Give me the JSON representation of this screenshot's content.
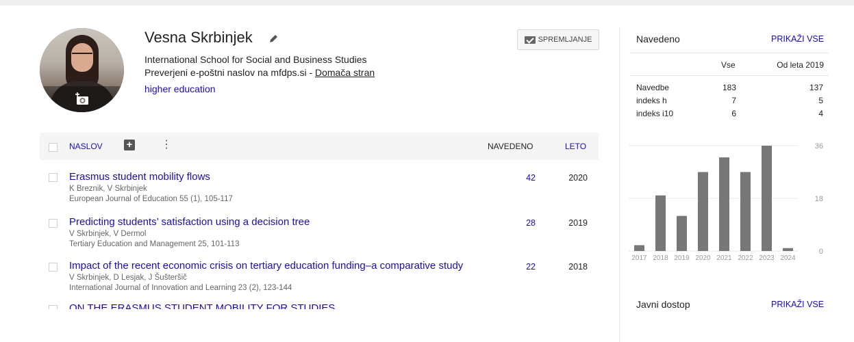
{
  "profile": {
    "name": "Vesna Skrbinjek",
    "affiliation": "International School for Social and Business Studies",
    "email_text": "Preverjeni e-poštni naslov na mfdps.si - ",
    "homepage_label": "Domača stran",
    "interest": "higher education",
    "follow_label": "SPREMLJANJE"
  },
  "table": {
    "col_title": "NASLOV",
    "col_cited": "NAVEDENO",
    "col_year": "LETO",
    "rows": [
      {
        "title": "Erasmus student mobility flows",
        "authors": "K Breznik, V Skrbinjek",
        "venue": "European Journal of Education 55 (1), 105-117",
        "cited": "42",
        "year": "2020"
      },
      {
        "title": "Predicting students’ satisfaction using a decision tree",
        "authors": "V Skrbinjek, V Dermol",
        "venue": "Tertiary Education and Management 25, 101-113",
        "cited": "28",
        "year": "2019"
      },
      {
        "title": "Impact of the recent economic crisis on tertiary education funding–a comparative study",
        "authors": "V Skrbinjek, D Lesjak, J Šušteršič",
        "venue": "International Journal of Innovation and Learning 23 (2), 123-144",
        "cited": "22",
        "year": "2018"
      }
    ],
    "partial_row_title": "ON THE ERASMUS STUDENT MOBILITY FOR STUDIES"
  },
  "sidebar": {
    "cited_title": "Navedeno",
    "show_all": "PRIKAŽI VSE",
    "col_all": "Vse",
    "col_since": "Od leta 2019",
    "metrics": [
      {
        "label": "Navedbe",
        "all": "183",
        "since": "137"
      },
      {
        "label": "indeks h",
        "all": "7",
        "since": "5"
      },
      {
        "label": "indeks i10",
        "all": "6",
        "since": "4"
      }
    ],
    "public_access_title": "Javni dostop",
    "public_access_link": "PRIKAŽI VSE"
  },
  "chart_data": {
    "type": "bar",
    "categories": [
      "2017",
      "2018",
      "2019",
      "2020",
      "2021",
      "2022",
      "2023",
      "2024"
    ],
    "values": [
      2,
      19,
      12,
      27,
      32,
      27,
      36,
      1
    ],
    "ylim": [
      0,
      36
    ],
    "yticks": [
      "0",
      "18",
      "36"
    ],
    "bar_color": "#777777",
    "grid": true
  }
}
